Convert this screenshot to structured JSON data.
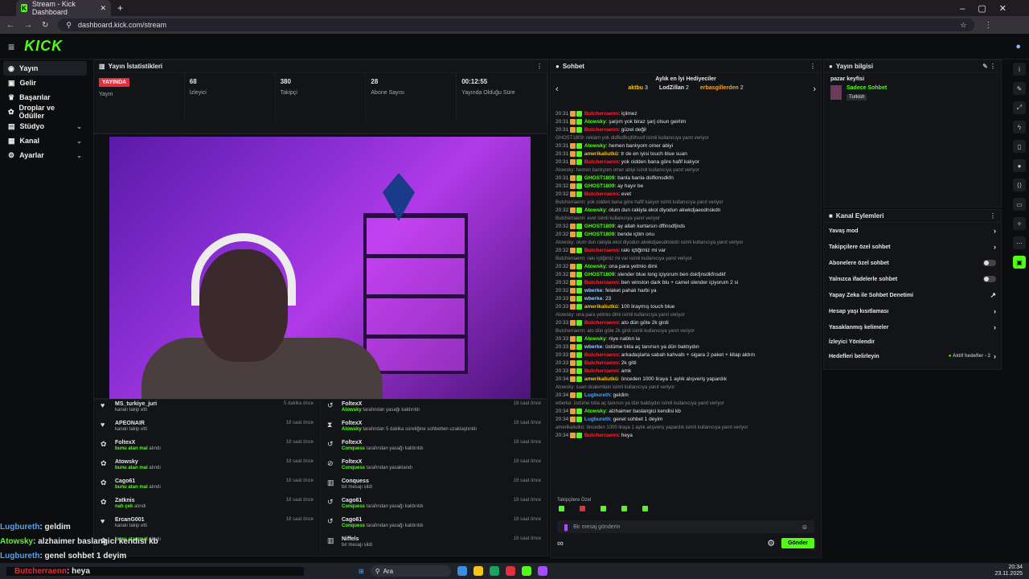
{
  "browser": {
    "tab_title": "Stream - Kick Dashboard",
    "url": "dashboard.kick.com/stream"
  },
  "brand": {
    "logo": "KICK"
  },
  "sidebar": {
    "items": [
      {
        "label": "Yayın",
        "active": true
      },
      {
        "label": "Gelir"
      },
      {
        "label": "Başarılar"
      },
      {
        "label": "Droplar ve Ödüller"
      },
      {
        "label": "Stüdyo",
        "chevron": true
      },
      {
        "label": "Kanal",
        "chevron": true
      },
      {
        "label": "Ayarlar",
        "chevron": true
      }
    ]
  },
  "stats": {
    "title": "Yayın İstatistikleri",
    "live_badge": "YAYINDA",
    "items": [
      {
        "value": "68",
        "label": "İzleyici"
      },
      {
        "value": "380",
        "label": "Takipçi"
      },
      {
        "value": "28",
        "label": "Abone Sayısı"
      },
      {
        "value": "00:12:55",
        "label": "Yayında Olduğu Süre"
      }
    ],
    "status_label": "Yayın"
  },
  "activity_left": [
    {
      "icon": "heart",
      "name": "MS_turkiye_juri",
      "sub": "kanalı takip etti",
      "time": "5 dakika önce"
    },
    {
      "icon": "heart",
      "name": "APEONAIR",
      "sub": "kanalı takip etti",
      "time": "18 saat önce"
    },
    {
      "icon": "gift",
      "name": "FoltexX",
      "sub_user": "bunu atan mal",
      "sub": "alındı",
      "time": "18 saat önce"
    },
    {
      "icon": "gift",
      "name": "Atowsky",
      "sub_user": "bunu atan mal",
      "sub": "alındı",
      "time": "18 saat önce"
    },
    {
      "icon": "gift",
      "name": "Cago61",
      "sub_user": "bunu atan mal",
      "sub": "alındı",
      "time": "18 saat önce"
    },
    {
      "icon": "gift",
      "name": "Zatknis",
      "sub_user": "nah çek",
      "sub": "alındı",
      "time": "18 saat önce"
    },
    {
      "icon": "heart",
      "name": "ErcanG001",
      "sub": "kanalı takip etti",
      "time": "18 saat önce"
    },
    {
      "icon": "gift",
      "name": "",
      "sub_user": "bunu atan mal",
      "sub": "alındı",
      "time": ""
    }
  ],
  "activity_right": [
    {
      "icon": "undo",
      "name": "FoltexX",
      "sub_user": "Atowsky",
      "sub": "tarafından yasağı kaldırıldı",
      "time": "18 saat önce"
    },
    {
      "icon": "hourglass",
      "name": "FoltexX",
      "sub_user": "Atowsky",
      "sub": "tarafından 5 dakika süreliğine sohbetten uzaklaştırıldı",
      "time": "18 saat önce"
    },
    {
      "icon": "undo",
      "name": "FoltexX",
      "sub_user": "Conquess",
      "sub": "tarafından yasağı kaldırıldı",
      "time": "18 saat önce"
    },
    {
      "icon": "ban",
      "name": "FoltexX",
      "sub_user": "Conquess",
      "sub": "tarafından yasaklandı",
      "time": "18 saat önce"
    },
    {
      "icon": "trash",
      "name": "Conquess",
      "sub": "bir mesajı sildi",
      "time": "18 saat önce"
    },
    {
      "icon": "undo",
      "name": "Cago61",
      "sub_user": "Conquess",
      "sub": "tarafından yasağı kaldırıldı",
      "time": "18 saat önce"
    },
    {
      "icon": "undo",
      "name": "Cago61",
      "sub_user": "Conquess",
      "sub": "tarafından yasağı kaldırıldı",
      "time": "18 saat önce"
    },
    {
      "icon": "trash",
      "name": "Niffels",
      "sub": "bir mesajı sildi",
      "time": "18 saat önce"
    }
  ],
  "chat": {
    "title": "Sohbet",
    "top_gifters_title": "Aylık en İyi Hediyeciler",
    "gifters": [
      {
        "name": "aktbu",
        "count": "3"
      },
      {
        "name": "LodZillan",
        "count": "2"
      },
      {
        "name": "erbasgillerden",
        "count": "2"
      }
    ],
    "messages": [
      {
        "time": "20:31",
        "user": "Butcherraenn",
        "color": "#e32e3b",
        "text": "içilmez"
      },
      {
        "time": "20:31",
        "user": "Atowsky",
        "color": "#53fc18",
        "text": "şarjım yok biraz şarj olsun geirlim"
      },
      {
        "time": "20:31",
        "user": "Butcherraenn",
        "color": "#e32e3b",
        "text": "güzel değil"
      },
      {
        "reply": "GHOST1809: reklam yok didfkdfksjfdhsulf isimli kullanıcıya yanıt veriyor"
      },
      {
        "time": "20:31",
        "user": "Atowsky",
        "color": "#53fc18",
        "text": "hemen banlıyom omer abiyi"
      },
      {
        "time": "20:31",
        "user": "amerikaliutkü",
        "color": "#f5c518",
        "text": "tr de en iyisi touch blue suan"
      },
      {
        "time": "20:31",
        "user": "Butcherraenn",
        "color": "#e32e3b",
        "text": "yok cidden bana göre hafif kalıyor"
      },
      {
        "reply": "Atowsky: hemen banlıyom omer abiyi isimli kullanıcıya yanıt veriyor"
      },
      {
        "time": "20:31",
        "user": "GHOST1809",
        "color": "#53fc18",
        "text": "banla banla dslfkmsdkfn"
      },
      {
        "time": "20:32",
        "user": "GHOST1809",
        "color": "#53fc18",
        "text": "ay hayır be"
      },
      {
        "time": "20:32",
        "user": "Butcherraenn",
        "color": "#e32e3b",
        "text": "evet"
      },
      {
        "reply": "Butcherraenn: yok cidden bana göre hafif kalıyor isimli kullanıcıya yanıt veriyor"
      },
      {
        "time": "20:32",
        "user": "Atowsky",
        "color": "#53fc18",
        "text": "olum dun rakiyla ekol diyodun akwkdjaeodnskdn"
      },
      {
        "reply": "Butcherraenn: evet isimli kullanıcıya yanıt veriyor"
      },
      {
        "time": "20:32",
        "user": "GHOST1809",
        "color": "#53fc18",
        "text": "ay allah kurtarsın dffinsdfjnds"
      },
      {
        "time": "20:32",
        "user": "GHOST1809",
        "color": "#53fc18",
        "text": "bende içtim onu"
      },
      {
        "reply": "Atowsky: olum dun rakiyla ekol diyodun akwkdjaeodnskdn isimli kullanıcıya yanıt veriyor"
      },
      {
        "time": "20:32",
        "user": "Butcherraenn",
        "color": "#e32e3b",
        "text": "rakı içtiğimiz mi var"
      },
      {
        "reply": "Butcherraenn: rakı içtiğimiz mi var isimli kullanıcıya yanıt veriyor"
      },
      {
        "time": "20:32",
        "user": "Atowsky",
        "color": "#53fc18",
        "text": "ona para yetmio dimi"
      },
      {
        "time": "20:32",
        "user": "GHOST1809",
        "color": "#53fc18",
        "text": "slender blue long içiyorum ben dskfjnsdkfnsdkf"
      },
      {
        "time": "20:32",
        "user": "Butcherraenn",
        "color": "#e32e3b",
        "text": "ben winston dark blu + camel slender içiyorum 2 si"
      },
      {
        "time": "20:32",
        "user": "wberke",
        "color": "#9ecbff",
        "text": "felaket pahalı harbi ya"
      },
      {
        "time": "20:33",
        "user": "wberke",
        "color": "#9ecbff",
        "text": "23"
      },
      {
        "time": "20:33",
        "user": "amerikaliutkü",
        "color": "#f5c518",
        "text": "100 liraymış touch blue"
      },
      {
        "reply": "Atowsky: ona para yetmio dimi isimli kullanıcıya yanıt veriyor"
      },
      {
        "time": "20:33",
        "user": "Butcherraenn",
        "color": "#e32e3b",
        "text": "ato dün göte 2k girdi"
      },
      {
        "reply": "Butcherraenn: ato dün göte 2k girdi isimli kullanıcıya yanıt veriyor"
      },
      {
        "time": "20:33",
        "user": "Atowsky",
        "color": "#53fc18",
        "text": "niye nabtın la"
      },
      {
        "time": "20:33",
        "user": "wberke",
        "color": "#9ecbff",
        "text": "üstüme tıkla aç tanırsın ya dün baktıydın"
      },
      {
        "time": "20:33",
        "user": "Butcherraenn",
        "color": "#e32e3b",
        "text": "arkadaşlarla sabah kahvaltı + sigara 2 paket + kitap aldım"
      },
      {
        "time": "20:33",
        "user": "Butcherraenn",
        "color": "#e32e3b",
        "text": "2k gitti"
      },
      {
        "time": "20:33",
        "user": "Butcherraenn",
        "color": "#e32e3b",
        "text": "amk"
      },
      {
        "time": "20:34",
        "user": "amerikaliutkü",
        "color": "#f5c518",
        "text": "önceden 1000 liraya 1 aylık alışveriş yapardık"
      },
      {
        "reply": "Atowsky: suan dcalemlain isimli kullanıcıya yanıt veriyor"
      },
      {
        "time": "20:34",
        "user": "Lugbureth",
        "color": "#4aa3ff",
        "text": "geldim"
      },
      {
        "reply": "wberke: üstüme tıkla aç tanırsın ya dün baktıydın isimli kullanıcıya yanıt veriyor"
      },
      {
        "time": "20:34",
        "user": "Atowsky",
        "color": "#53fc18",
        "text": "alzhaimer baslangici kendisi kb"
      },
      {
        "time": "20:34",
        "user": "Lugbureth",
        "color": "#4aa3ff",
        "text": "genel sohbet 1 deyim"
      },
      {
        "reply": "amerikaliutkü: önceden 1000 liraya 1 aylık alışveriş yapardık isimli kullanıcıya yanıt veriyor"
      },
      {
        "time": "20:34",
        "user": "Butcherraenn",
        "color": "#e32e3b",
        "text": "heya"
      }
    ],
    "followers_only": "Takipçilere Özel",
    "input_placeholder": "Bir mesaj gönderin",
    "send_label": "Gönder"
  },
  "stream_info": {
    "title": "Yayın bilgisi",
    "stream_title": "pazar keyfisi",
    "category": "Sadece Sohbet",
    "language": "Turkish"
  },
  "channel_actions": {
    "title": "Kanal Eylemleri",
    "items": [
      {
        "label": "Yavaş mod",
        "type": "arrow"
      },
      {
        "label": "Takipçilere özel sohbet",
        "type": "arrow"
      },
      {
        "label": "Abonelere özel sohbet",
        "type": "toggle"
      },
      {
        "label": "Yalnızca ifadelerle sohbet",
        "type": "toggle"
      },
      {
        "label": "Yapay Zeka ile Sohbet Denetimi",
        "type": "external"
      },
      {
        "label": "Hesap yaşı kısıtlaması",
        "type": "arrow"
      },
      {
        "label": "Yasaklanmış kelimeler",
        "type": "arrow"
      },
      {
        "label": "İzleyici Yönlendir",
        "type": "none"
      },
      {
        "label": "Hedefleri belirleyin",
        "type": "arrow",
        "note": "Aktif hedefler - 2"
      }
    ]
  },
  "overlay_chat": [
    {
      "user": "Lugbureth",
      "color": "#4aa3ff",
      "text": ": geldim"
    },
    {
      "user": "Atowsky",
      "color": "#53fc18",
      "text": ": alzhaimer baslangici kendisi kb"
    },
    {
      "user": "Lugbureth",
      "color": "#4aa3ff",
      "text": ": genel sohbet 1 deyim"
    },
    {
      "user": "Butcherraenn",
      "color": "#e32e3b",
      "text": ": heya"
    }
  ],
  "taskbar": {
    "search": "Ara",
    "time": "20:34",
    "date": "23.11.2025"
  }
}
